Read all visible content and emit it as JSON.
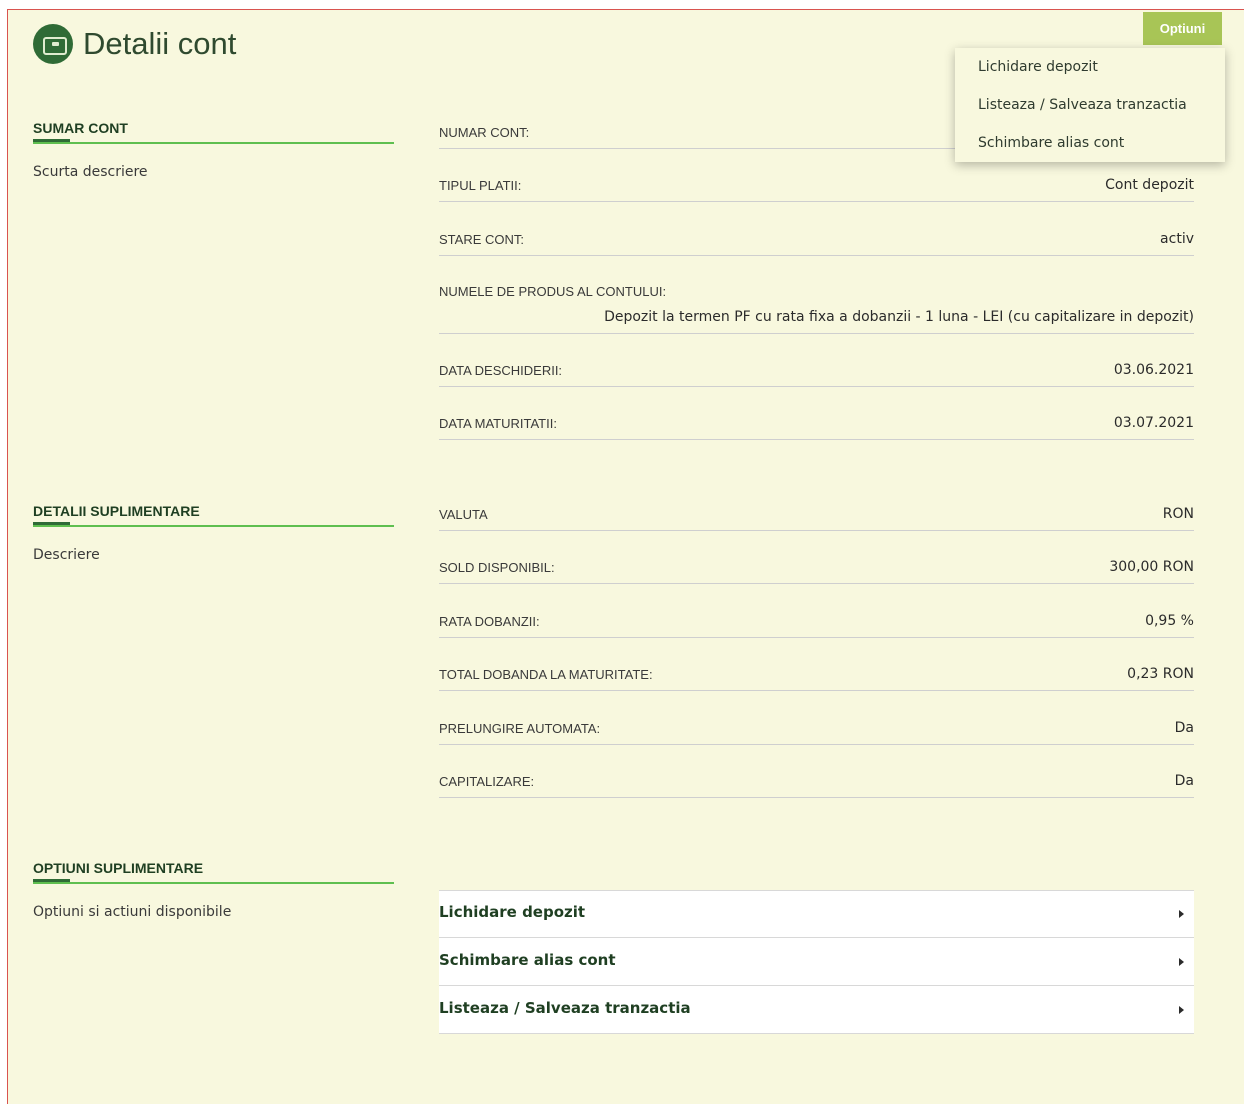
{
  "header": {
    "title": "Detalii cont",
    "icon": "wallet-icon"
  },
  "options_button": {
    "label": "Optiuni"
  },
  "dropdown": {
    "items": [
      "Lichidare depozit",
      "Listeaza / Salveaza tranzactia",
      "Schimbare alias cont"
    ]
  },
  "sections": {
    "summary": {
      "title": "SUMAR CONT",
      "desc": "Scurta descriere"
    },
    "details": {
      "title": "DETALII SUPLIMENTARE",
      "desc": "Descriere"
    },
    "options": {
      "title": "OPTIUNI SUPLIMENTARE",
      "desc": "Optiuni si actiuni disponibile"
    }
  },
  "summary_rows": [
    {
      "label": "NUMAR CONT:",
      "value": ""
    },
    {
      "label": "TIPUL PLATII:",
      "value": "Cont depozit"
    },
    {
      "label": "STARE CONT:",
      "value": "activ"
    },
    {
      "label": "NUMELE DE PRODUS AL CONTULUI:",
      "value": "Depozit la termen PF cu rata fixa a dobanzii - 1 luna - LEI (cu capitalizare in depozit)"
    },
    {
      "label": "DATA DESCHIDERII:",
      "value": "03.06.2021"
    },
    {
      "label": "DATA MATURITATII:",
      "value": "03.07.2021"
    }
  ],
  "detail_rows": [
    {
      "label": "VALUTA",
      "value": "RON"
    },
    {
      "label": "SOLD DISPONIBIL:",
      "value": "300,00 RON"
    },
    {
      "label": "RATA DOBANZII:",
      "value": "0,95 %"
    },
    {
      "label": "TOTAL DOBANDA LA MATURITATE:",
      "value": "0,23 RON"
    },
    {
      "label": "PRELUNGIRE AUTOMATA:",
      "value": "Da"
    },
    {
      "label": "CAPITALIZARE:",
      "value": "Da"
    }
  ],
  "option_rows": [
    {
      "label": "Lichidare depozit"
    },
    {
      "label": "Schimbare alias cont"
    },
    {
      "label": "Listeaza / Salveaza tranzactia"
    }
  ],
  "colors": {
    "accent": "#a8c556",
    "brand_dark": "#2f6b36",
    "background": "#f8f8de",
    "line": "#5fbf4f"
  }
}
